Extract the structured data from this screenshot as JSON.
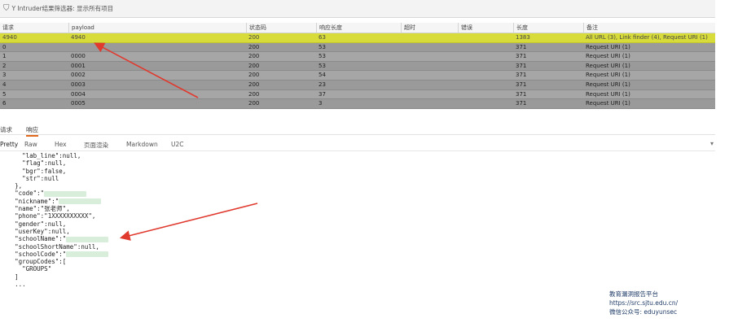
{
  "filter": {
    "icon": "filter-icon",
    "text": "Y  Intruder结果筛选器: 显示所有项目"
  },
  "table": {
    "headers": [
      "请求",
      "payload",
      "状态码",
      "响应长度",
      "超时",
      "错误",
      "长度",
      "备注"
    ],
    "rows": [
      [
        "4940",
        "4940",
        "200",
        "63",
        "",
        "",
        "1383",
        "All URL (3), Link finder (4), Request URI (1)"
      ],
      [
        "0",
        "",
        "200",
        "53",
        "",
        "",
        "371",
        "Request URI (1)"
      ],
      [
        "1",
        "0000",
        "200",
        "53",
        "",
        "",
        "371",
        "Request URI (1)"
      ],
      [
        "2",
        "0001",
        "200",
        "53",
        "",
        "",
        "371",
        "Request URI (1)"
      ],
      [
        "3",
        "0002",
        "200",
        "54",
        "",
        "",
        "371",
        "Request URI (1)"
      ],
      [
        "4",
        "0003",
        "200",
        "23",
        "",
        "",
        "371",
        "Request URI (1)"
      ],
      [
        "5",
        "0004",
        "200",
        "37",
        "",
        "",
        "371",
        "Request URI (1)"
      ],
      [
        "6",
        "0005",
        "200",
        "3",
        "",
        "",
        "371",
        "Request URI (1)"
      ]
    ],
    "selected_row": 0
  },
  "detail_tabs": [
    "请求",
    "响应"
  ],
  "detail_active": 1,
  "view_tabs": [
    "Pretty",
    "Raw",
    "Hex",
    "页面渲染",
    "Markdown",
    "U2C"
  ],
  "view_active": 0,
  "code_lines": [
    {
      "indent": "      ",
      "text": "\"lab_line\":null,"
    },
    {
      "indent": "      ",
      "text": "\"flag\":null,"
    },
    {
      "indent": "      ",
      "text": "\"bgr\":false,"
    },
    {
      "indent": "      ",
      "text": "\"str\":null"
    },
    {
      "indent": "    ",
      "text": "},"
    },
    {
      "indent": "    ",
      "text": "\"code\":\"",
      "blur": true
    },
    {
      "indent": "    ",
      "text": "\"nickname\":\"",
      "blur": true
    },
    {
      "indent": "    ",
      "text": "\"name\":\"张老师\","
    },
    {
      "indent": "    ",
      "text": "\"phone\":\"1XXXXXXXXXX\","
    },
    {
      "indent": "    ",
      "text": "\"gender\":null,"
    },
    {
      "indent": "    ",
      "text": "\"userKey\":null,"
    },
    {
      "indent": "    ",
      "text": "\"schoolName\":\"",
      "blur": true
    },
    {
      "indent": "    ",
      "text": "\"schoolShortName\":null,"
    },
    {
      "indent": "    ",
      "text": "\"schoolCode\":\"",
      "blur": true
    },
    {
      "indent": "    ",
      "text": "\"groupCodes\":["
    },
    {
      "indent": "      ",
      "text": "\"GROUPS\""
    },
    {
      "indent": "    ",
      "text": "]"
    },
    {
      "indent": "    ",
      "text": "..."
    }
  ],
  "watermark": {
    "line1": "教育漏洞报告平台",
    "line2": "https://src.sjtu.edu.cn/",
    "line3": "微信公众号: eduyunsec"
  }
}
